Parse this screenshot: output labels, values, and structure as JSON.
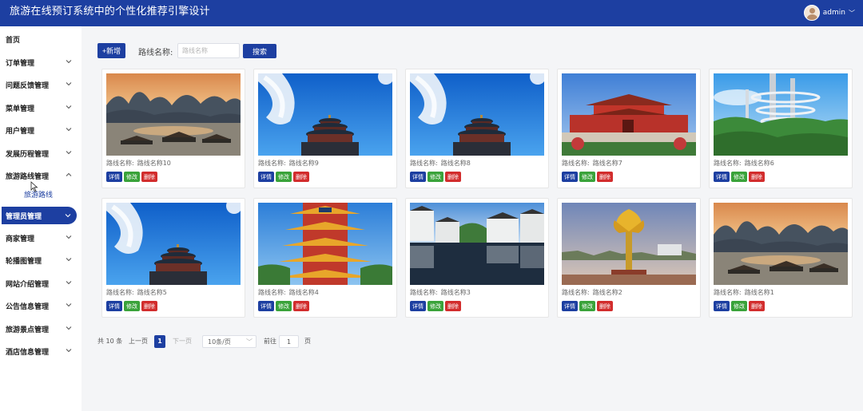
{
  "header": {
    "title": "旅游在线预订系统中的个性化推荐引擎设计",
    "user": "admin"
  },
  "sidebar": {
    "items": [
      {
        "label": "首页"
      },
      {
        "label": "订单管理"
      },
      {
        "label": "问题反馈管理"
      },
      {
        "label": "菜单管理"
      },
      {
        "label": "用户管理"
      },
      {
        "label": "发展历程管理"
      },
      {
        "label": "旅游路线管理"
      },
      {
        "label": "管理员管理"
      },
      {
        "label": "商家管理"
      },
      {
        "label": "轮播图管理"
      },
      {
        "label": "网站介绍管理"
      },
      {
        "label": "公告信息管理"
      },
      {
        "label": "旅游景点管理"
      },
      {
        "label": "酒店信息管理"
      }
    ],
    "sub_item": "旅游路线"
  },
  "toolbar": {
    "add_label": "+新增",
    "filter_label": "路线名称:",
    "filter_placeholder": "路线名称",
    "search_label": "搜索"
  },
  "cards": [
    {
      "label": "路线名称:",
      "value": "路线名称10",
      "scene": "lake-karst"
    },
    {
      "label": "路线名称:",
      "value": "路线名称9",
      "scene": "temple-sky"
    },
    {
      "label": "路线名称:",
      "value": "路线名称8",
      "scene": "temple-sky"
    },
    {
      "label": "路线名称:",
      "value": "路线名称7",
      "scene": "tiananmen"
    },
    {
      "label": "路线名称:",
      "value": "路线名称6",
      "scene": "spiral-tower"
    },
    {
      "label": "路线名称:",
      "value": "路线名称5",
      "scene": "temple-sky"
    },
    {
      "label": "路线名称:",
      "value": "路线名称4",
      "scene": "yellow-tower"
    },
    {
      "label": "路线名称:",
      "value": "路线名称3",
      "scene": "village-water"
    },
    {
      "label": "路线名称:",
      "value": "路线名称2",
      "scene": "golden-lotus"
    },
    {
      "label": "路线名称:",
      "value": "路线名称1",
      "scene": "lake-karst"
    }
  ],
  "card_actions": {
    "detail": "详情",
    "edit": "修改",
    "delete": "删除"
  },
  "pagination": {
    "total": "共 10 条",
    "prev": "上一页",
    "current": "1",
    "next": "下一页",
    "page_size": "10条/页",
    "goto": "前往",
    "goto_value": "1",
    "page_unit": "页"
  },
  "colors": {
    "primary": "#1d3fa1",
    "edit": "#3aa33a",
    "delete": "#d22d2d"
  }
}
